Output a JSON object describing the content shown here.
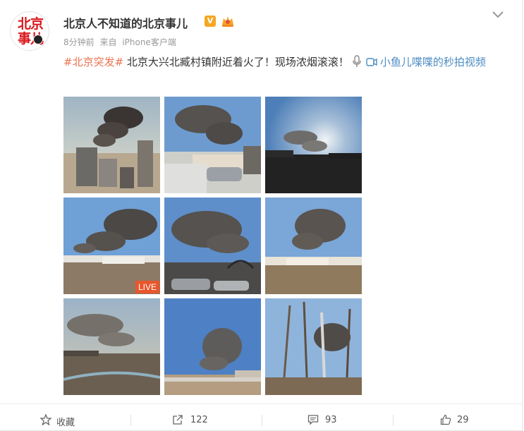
{
  "post": {
    "username": "北京人不知道的北京事儿",
    "verified_badge": "V",
    "time": "8分钟前",
    "source_prefix": "来自",
    "source": "iPhone客户端",
    "hashtag": "#北京突发#",
    "text": " 北京大兴北臧村镇附近着火了！现场浓烟滚滚！",
    "video_link": "小鱼儿喋喋的秒拍视频",
    "live_badge": "LIVE"
  },
  "avatar": {
    "line1": "北京",
    "line2": "事儿"
  },
  "actions": {
    "favorite": "收藏",
    "forward": "122",
    "comment": "93",
    "like": "29"
  },
  "colors": {
    "hashtag": "#eb7350",
    "link": "#4a8bc2",
    "avatar_red": "#d9161a",
    "live": "#e8562c"
  },
  "icons": [
    "chevron-down-icon",
    "microphone-icon",
    "video-icon",
    "star-icon",
    "share-icon",
    "comment-icon",
    "thumbs-up-icon",
    "crown-icon"
  ]
}
